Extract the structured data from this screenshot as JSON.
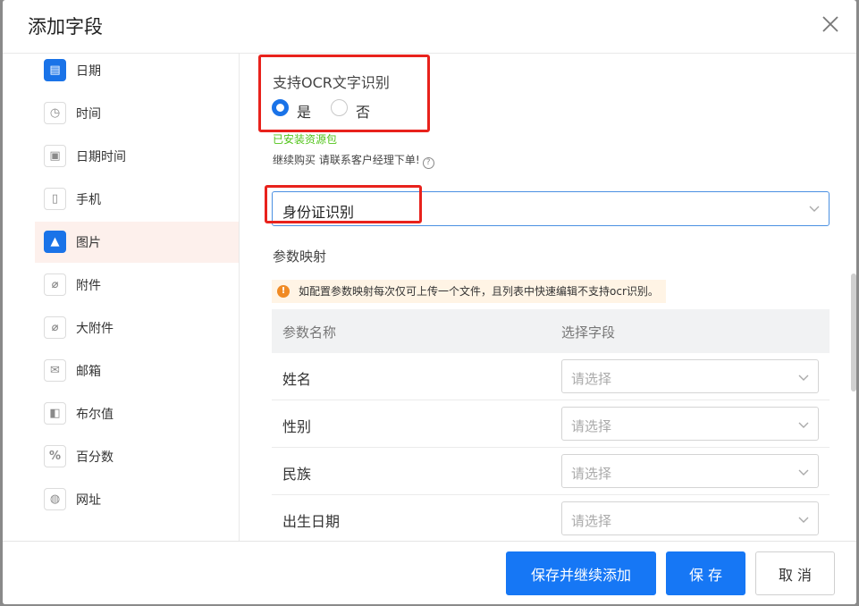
{
  "dialog": {
    "title": "添加字段"
  },
  "sidebar": {
    "items": [
      {
        "label": "日期",
        "icon": "calendar-icon",
        "glyph": "▤"
      },
      {
        "label": "时间",
        "icon": "clock-icon",
        "glyph": "◷"
      },
      {
        "label": "日期时间",
        "icon": "datetime-icon",
        "glyph": "▣"
      },
      {
        "label": "手机",
        "icon": "phone-icon",
        "glyph": "▯"
      },
      {
        "label": "图片",
        "icon": "image-icon",
        "glyph": "▲"
      },
      {
        "label": "附件",
        "icon": "paperclip-icon",
        "glyph": "⌀"
      },
      {
        "label": "大附件",
        "icon": "large-attachment-icon",
        "glyph": "⌀"
      },
      {
        "label": "邮箱",
        "icon": "mail-icon",
        "glyph": "✉"
      },
      {
        "label": "布尔值",
        "icon": "boolean-icon",
        "glyph": "◧"
      },
      {
        "label": "百分数",
        "icon": "percent-icon",
        "glyph": "%"
      },
      {
        "label": "网址",
        "icon": "globe-icon",
        "glyph": "◍"
      }
    ]
  },
  "ocr": {
    "label": "支持OCR文字识别",
    "yes": "是",
    "no": "否",
    "selected": "是",
    "installed": "已安装资源包",
    "continue": "继续购买 请联系客户经理下单!",
    "help_glyph": "?"
  },
  "recognition_select": {
    "value": "身份证识别"
  },
  "mapping": {
    "title": "参数映射",
    "warning": "如配置参数映射每次仅可上传一个文件，且列表中快速编辑不支持ocr识别。",
    "warning_glyph": "!",
    "headers": {
      "name": "参数名称",
      "field": "选择字段"
    },
    "rows": [
      {
        "name": "姓名",
        "placeholder": "请选择"
      },
      {
        "name": "性别",
        "placeholder": "请选择"
      },
      {
        "name": "民族",
        "placeholder": "请选择"
      },
      {
        "name": "出生日期",
        "placeholder": "请选择"
      }
    ]
  },
  "footer": {
    "save_continue": "保存并继续添加",
    "save": "保 存",
    "cancel": "取 消"
  },
  "colors": {
    "primary": "#1677f5",
    "highlight": "#e8221c",
    "success": "#52c41a",
    "warning": "#f08a24"
  }
}
